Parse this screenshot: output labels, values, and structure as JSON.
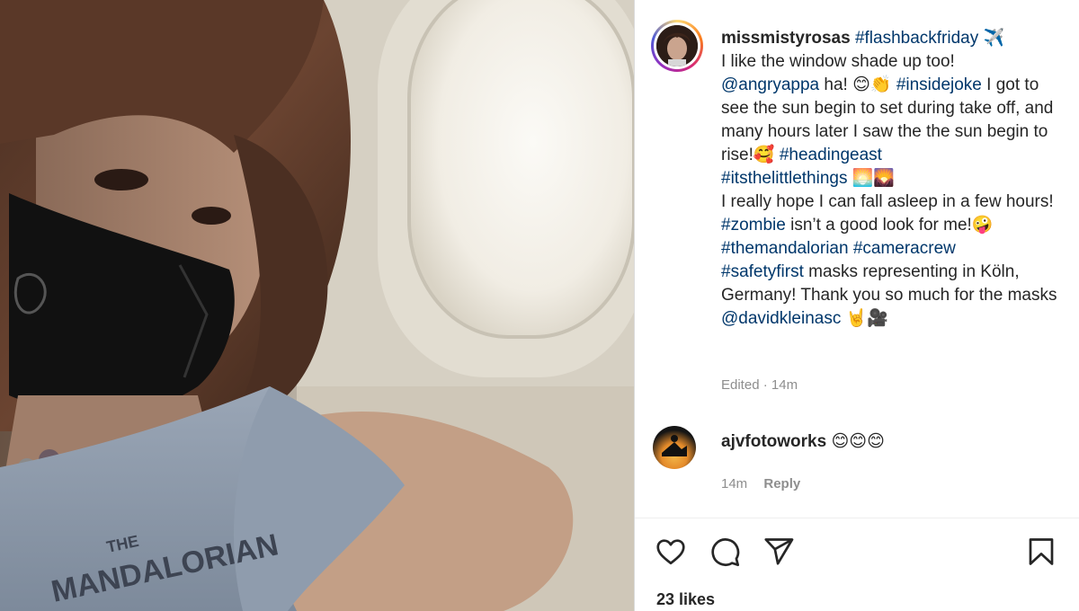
{
  "post": {
    "username": "missmistyrosas",
    "caption_segments": [
      {
        "text": "#flashbackfriday",
        "type": "tag"
      },
      {
        "text": " ✈️\nI like the window shade up too!\n",
        "type": "text"
      },
      {
        "text": "@angryappa",
        "type": "tag"
      },
      {
        "text": " ha! 😊👏 ",
        "type": "text"
      },
      {
        "text": "#insidejoke",
        "type": "tag"
      },
      {
        "text": " I got to see the sun begin to set during take off, and many hours later I saw the the sun begin to rise!🥰 ",
        "type": "text"
      },
      {
        "text": "#headingeast",
        "type": "tag"
      },
      {
        "text": "\n",
        "type": "text"
      },
      {
        "text": "#itsthelittlethings",
        "type": "tag"
      },
      {
        "text": " 🌅🌄\nI really hope I can fall asleep in a few hours! ",
        "type": "text"
      },
      {
        "text": "#zombie",
        "type": "tag"
      },
      {
        "text": " isn’t a good look for me!🤪\n",
        "type": "text"
      },
      {
        "text": "#themandalorian",
        "type": "tag"
      },
      {
        "text": " ",
        "type": "text"
      },
      {
        "text": "#cameracrew",
        "type": "tag"
      },
      {
        "text": "\n",
        "type": "text"
      },
      {
        "text": "#safetyfirst",
        "type": "tag"
      },
      {
        "text": " masks representing in Köln, Germany! Thank you so much for the masks ",
        "type": "text"
      },
      {
        "text": "@davidkleinasc",
        "type": "tag"
      },
      {
        "text": " 🤘🎥",
        "type": "text"
      }
    ],
    "edited_label": "Edited",
    "time": "14m"
  },
  "comment": {
    "username": "ajvfotoworks",
    "text": "😊😊😊",
    "time": "14m",
    "reply_label": "Reply"
  },
  "actions": {
    "icons": [
      "heart-icon",
      "comment-icon",
      "share-icon",
      "bookmark-icon"
    ]
  },
  "likes": "23 likes",
  "shirt_text": [
    "THE",
    "MANDALORIAN"
  ],
  "colors": {
    "link": "#00376b",
    "muted": "#8e8e8e",
    "text": "#262626"
  }
}
